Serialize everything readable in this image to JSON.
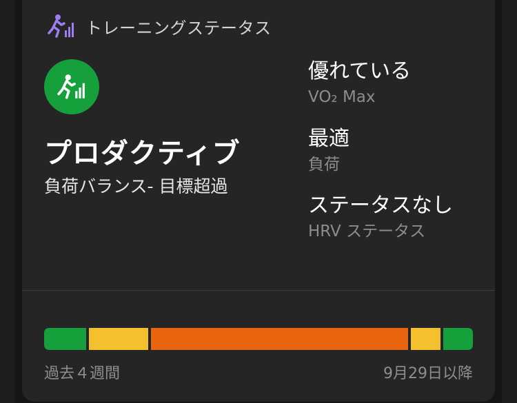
{
  "header": {
    "title": "トレーニングステータス",
    "icon": "training-status-icon"
  },
  "status": {
    "title": "プロダクティブ",
    "subtitle": "負荷バランス- 目標超過",
    "icon": "runner-bars-icon",
    "color": "#15a03c"
  },
  "metrics": [
    {
      "value": "優れている",
      "label": "VO₂ Max"
    },
    {
      "value": "最適",
      "label": "負荷"
    },
    {
      "value": "ステータスなし",
      "label": "HRV ステータス"
    }
  ],
  "history_bar": {
    "segments": [
      {
        "color": "#15a03c",
        "share": 10
      },
      {
        "color": "#f5c02e",
        "share": 14
      },
      {
        "color": "#e8640f",
        "share": 61
      },
      {
        "color": "#f5c02e",
        "share": 7
      },
      {
        "color": "#15a03c",
        "share": 7
      }
    ]
  },
  "footer": {
    "left": "過去４週間",
    "right": "9月29日以降"
  }
}
